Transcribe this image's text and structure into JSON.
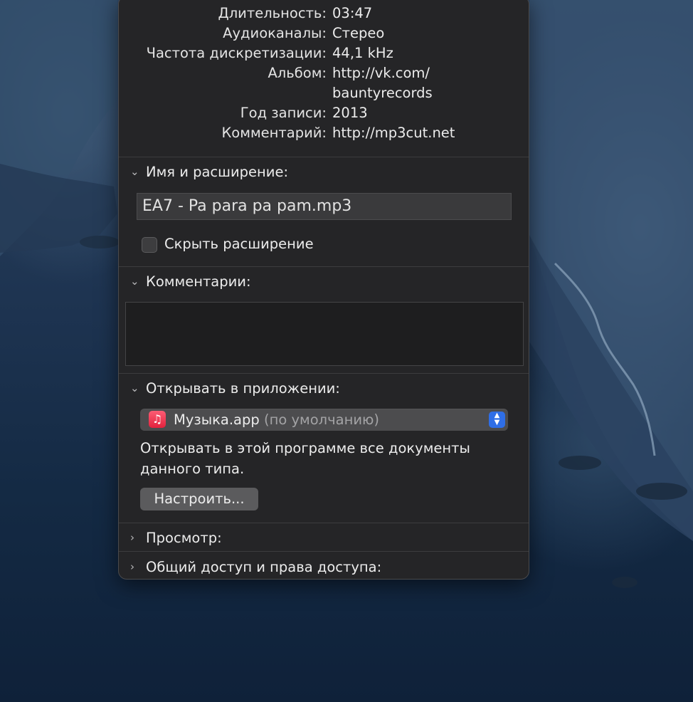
{
  "metadata": [
    {
      "key": "Длительность:",
      "value": "03:47"
    },
    {
      "key": "Аудиоканалы:",
      "value": "Стерео"
    },
    {
      "key": "Частота дискретизации:",
      "value": "44,1 kHz"
    },
    {
      "key": "Альбом:",
      "value": "http://vk.com/"
    },
    {
      "key": "",
      "value": "bauntyrecords"
    },
    {
      "key": "Год записи:",
      "value": "2013"
    },
    {
      "key": "Комментарий:",
      "value": "http://mp3cut.net"
    }
  ],
  "name_section": {
    "title": "Имя и расширение:",
    "filename": "EA7 - Pa para pa pam.mp3",
    "hide_extension_label": "Скрыть расширение",
    "hide_extension_checked": false
  },
  "comments_section": {
    "title": "Комментарии:",
    "value": ""
  },
  "open_with_section": {
    "title": "Открывать в приложении:",
    "app_name": "Музыка.app",
    "app_default": "(по умолчанию)",
    "app_icon": "music-note-icon",
    "description_line1": "Открывать в этой программе все документы",
    "description_line2": "данного типа.",
    "configure_button": "Настроить..."
  },
  "preview_section": {
    "title": "Просмотр:"
  },
  "sharing_section": {
    "title": "Общий доступ и права доступа:"
  },
  "colors": {
    "window_bg": "#252527",
    "accent": "#2f6ee6",
    "music_icon": "#f43a56"
  }
}
